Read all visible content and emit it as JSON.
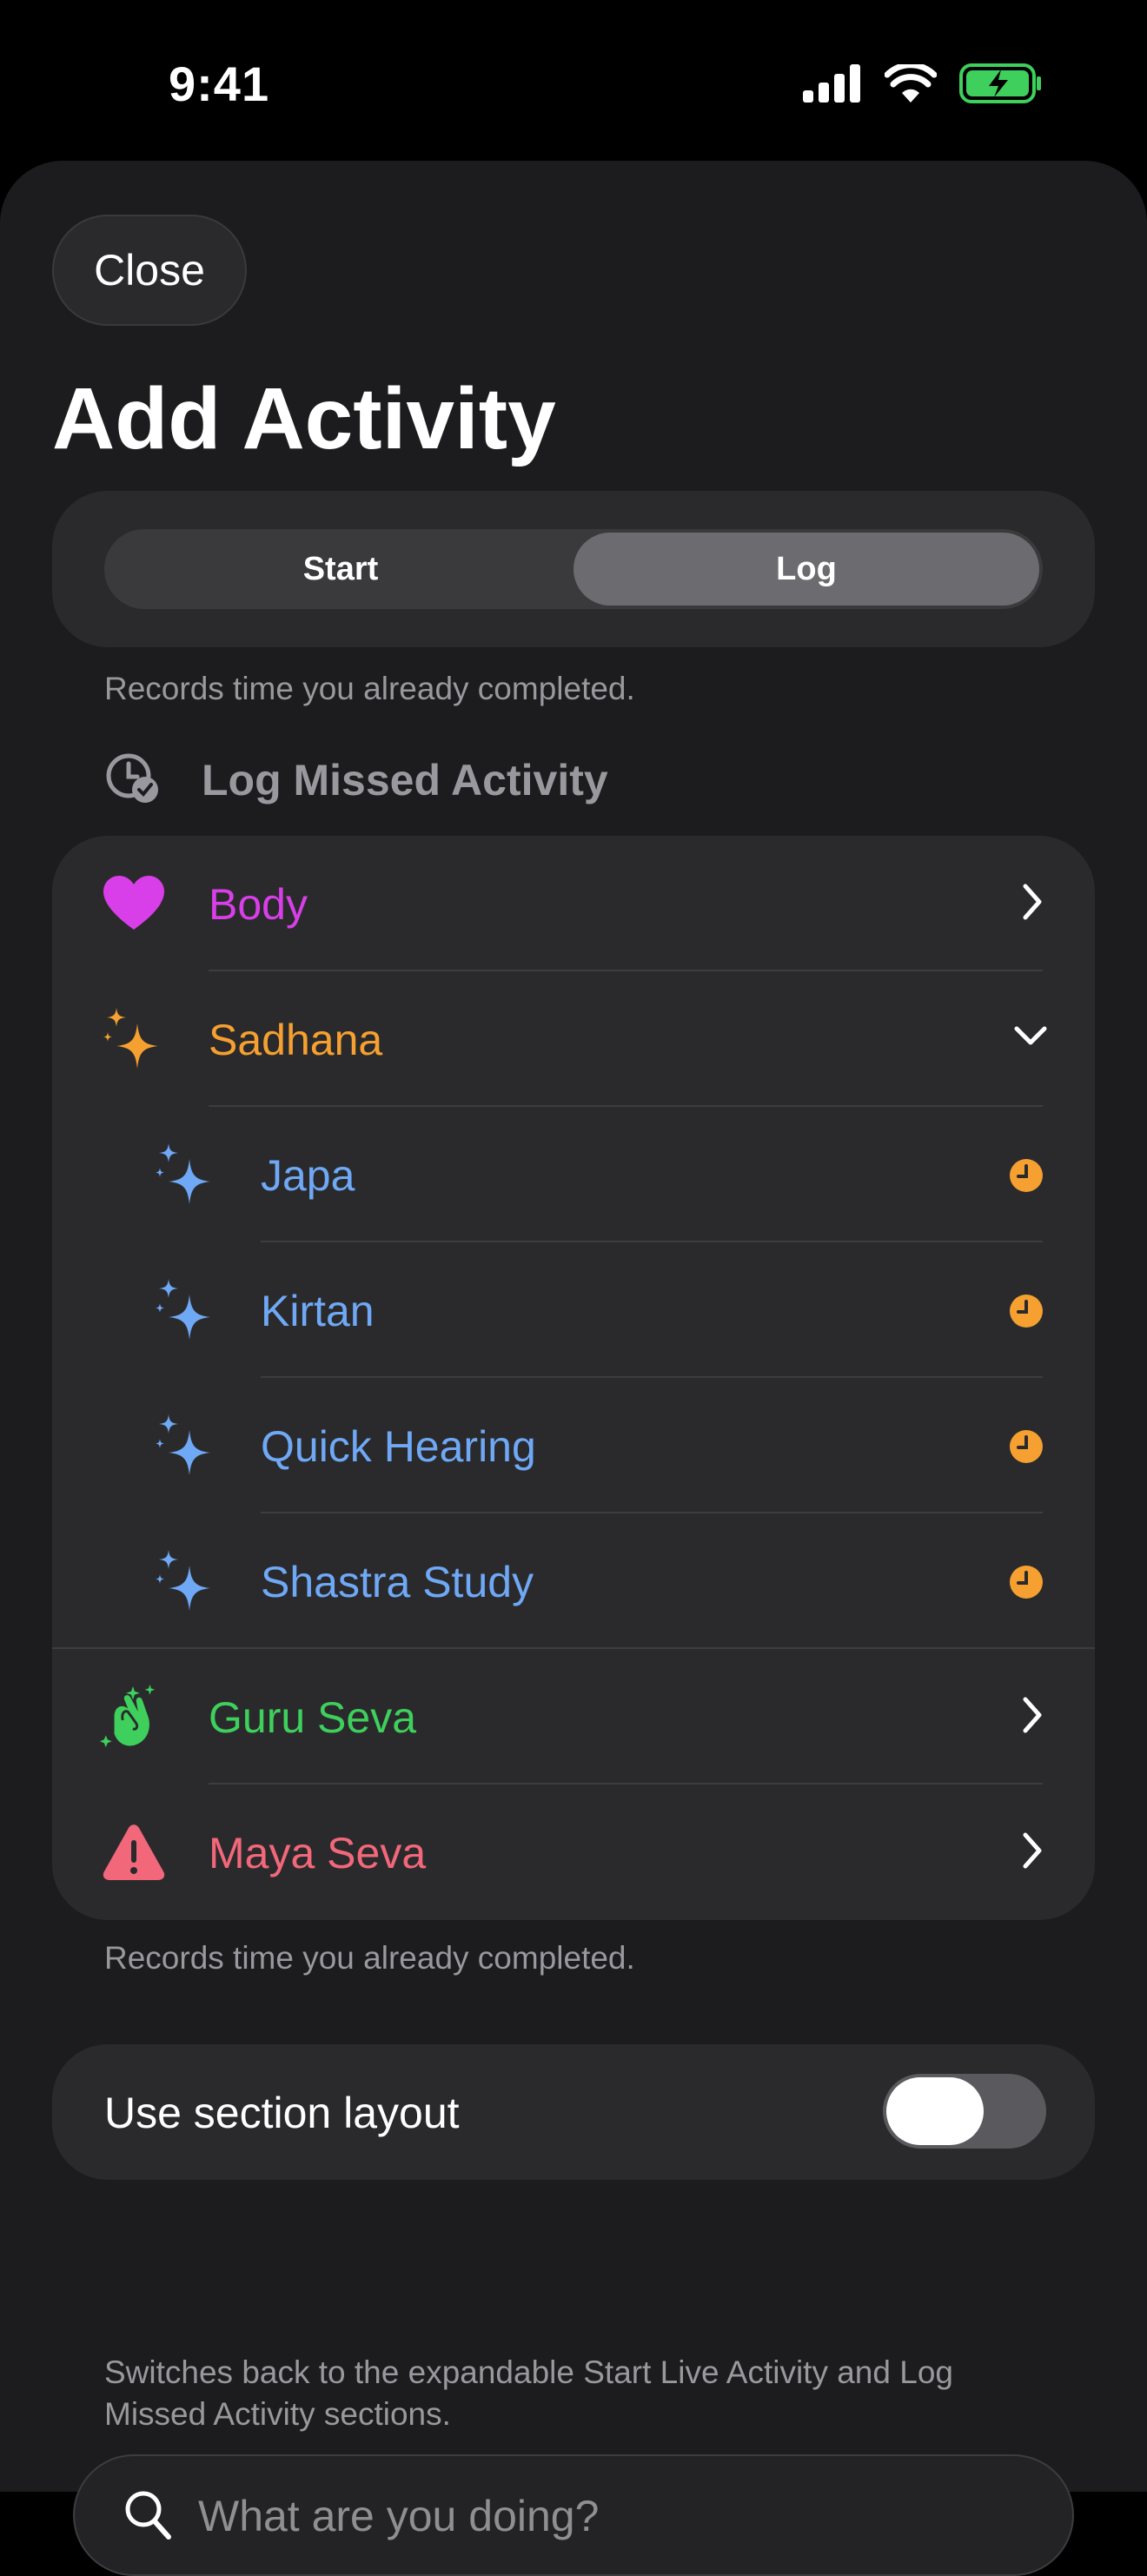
{
  "status_bar": {
    "time": "9:41"
  },
  "header": {
    "close_label": "Close",
    "title": "Add Activity"
  },
  "mode_segment": {
    "options": [
      "Start",
      "Log"
    ],
    "selected": "Log"
  },
  "mode_note": "Records time you already completed.",
  "section": {
    "title": "Log Missed Activity",
    "icon": "clock-check-icon"
  },
  "activities": [
    {
      "label": "Body",
      "color": "#d93fe8",
      "icon": "heart-icon",
      "accessory": "chevron-right"
    },
    {
      "label": "Sadhana",
      "color": "#f5a030",
      "icon": "sparkles-icon",
      "accessory": "chevron-down"
    },
    {
      "label": "Japa",
      "color": "#6fa8f5",
      "icon": "sparkles-icon",
      "accessory": "clock",
      "indent": true
    },
    {
      "label": "Kirtan",
      "color": "#6fa8f5",
      "icon": "sparkles-icon",
      "accessory": "clock",
      "indent": true
    },
    {
      "label": "Quick Hearing",
      "color": "#6fa8f5",
      "icon": "sparkles-icon",
      "accessory": "clock",
      "indent": true
    },
    {
      "label": "Shastra Study",
      "color": "#6fa8f5",
      "icon": "sparkles-icon",
      "accessory": "clock",
      "indent": true
    },
    {
      "label": "Guru Seva",
      "color": "#3ecf5c",
      "icon": "hands-clapping-icon",
      "accessory": "chevron-right"
    },
    {
      "label": "Maya Seva",
      "color": "#f2687a",
      "icon": "warning-triangle-icon",
      "accessory": "chevron-right"
    }
  ],
  "list_note": "Records time you already completed.",
  "layout_toggle": {
    "label": "Use section layout",
    "on": false
  },
  "layout_note": "Switches back to the expandable Start Live Activity and Log Missed Activity sections.",
  "search": {
    "placeholder": "What are you doing?"
  },
  "colors": {
    "clock_accent": "#f5a030",
    "battery_green": "#3ecf5c"
  }
}
